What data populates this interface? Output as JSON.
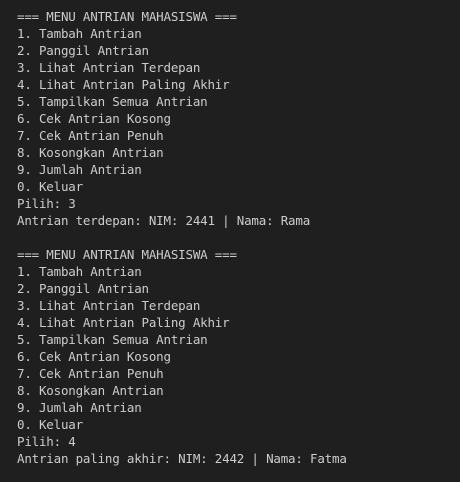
{
  "terminal": {
    "blocks": [
      {
        "header": "=== MENU ANTRIAN MAHASISWA ===",
        "menu": [
          "1. Tambah Antrian",
          "2. Panggil Antrian",
          "3. Lihat Antrian Terdepan",
          "4. Lihat Antrian Paling Akhir",
          "5. Tampilkan Semua Antrian",
          "6. Cek Antrian Kosong",
          "7. Cek Antrian Penuh",
          "8. Kosongkan Antrian",
          "9. Jumlah Antrian",
          "0. Keluar"
        ],
        "prompt": "Pilih: 3",
        "result": "Antrian terdepan: NIM: 2441 | Nama: Rama"
      },
      {
        "header": "=== MENU ANTRIAN MAHASISWA ===",
        "menu": [
          "1. Tambah Antrian",
          "2. Panggil Antrian",
          "3. Lihat Antrian Terdepan",
          "4. Lihat Antrian Paling Akhir",
          "5. Tampilkan Semua Antrian",
          "6. Cek Antrian Kosong",
          "7. Cek Antrian Penuh",
          "8. Kosongkan Antrian",
          "9. Jumlah Antrian",
          "0. Keluar"
        ],
        "prompt": "Pilih: 4",
        "result": "Antrian paling akhir: NIM: 2442 | Nama: Fatma"
      }
    ]
  }
}
